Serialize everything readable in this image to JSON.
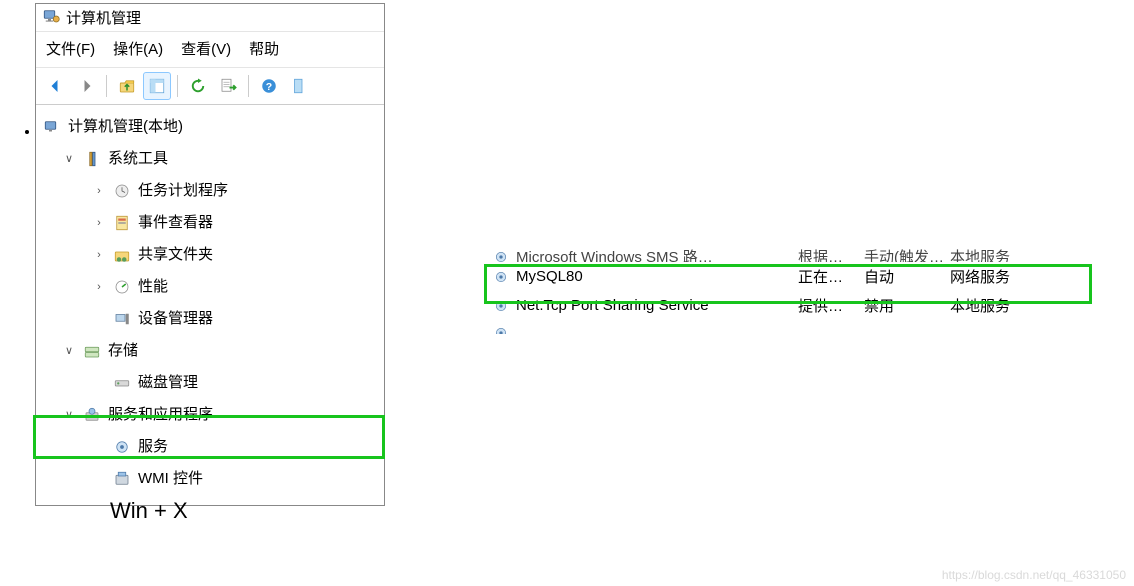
{
  "window": {
    "title": "计算机管理"
  },
  "menu": {
    "file": "文件(F)",
    "action": "操作(A)",
    "view": "查看(V)",
    "help": "帮助"
  },
  "tree": {
    "root": "计算机管理(本地)",
    "systools": "系统工具",
    "schedtasks": "任务计划程序",
    "eventviewer": "事件查看器",
    "sharedfolders": "共享文件夹",
    "performance": "性能",
    "devicemgr": "设备管理器",
    "storage": "存储",
    "diskmgmt": "磁盘管理",
    "servicesapps": "服务和应用程序",
    "services": "服务",
    "wmi": "WMI 控件"
  },
  "annotation": "Win + X",
  "services": {
    "rows": [
      {
        "name": "Microsoft Windows SMS 路…",
        "desc": "根据…",
        "startup": "手动(触发…",
        "logon": "本地服务"
      },
      {
        "name": "MySQL80",
        "desc": "正在…",
        "startup": "自动",
        "logon": "网络服务"
      },
      {
        "name": "Net.Tcp Port Sharing Service",
        "desc": "提供…",
        "startup": "禁用",
        "logon": "本地服务"
      },
      {
        "name": "",
        "desc": "",
        "startup": "",
        "logon": ""
      }
    ]
  },
  "watermark": "https://blog.csdn.net/qq_46331050"
}
